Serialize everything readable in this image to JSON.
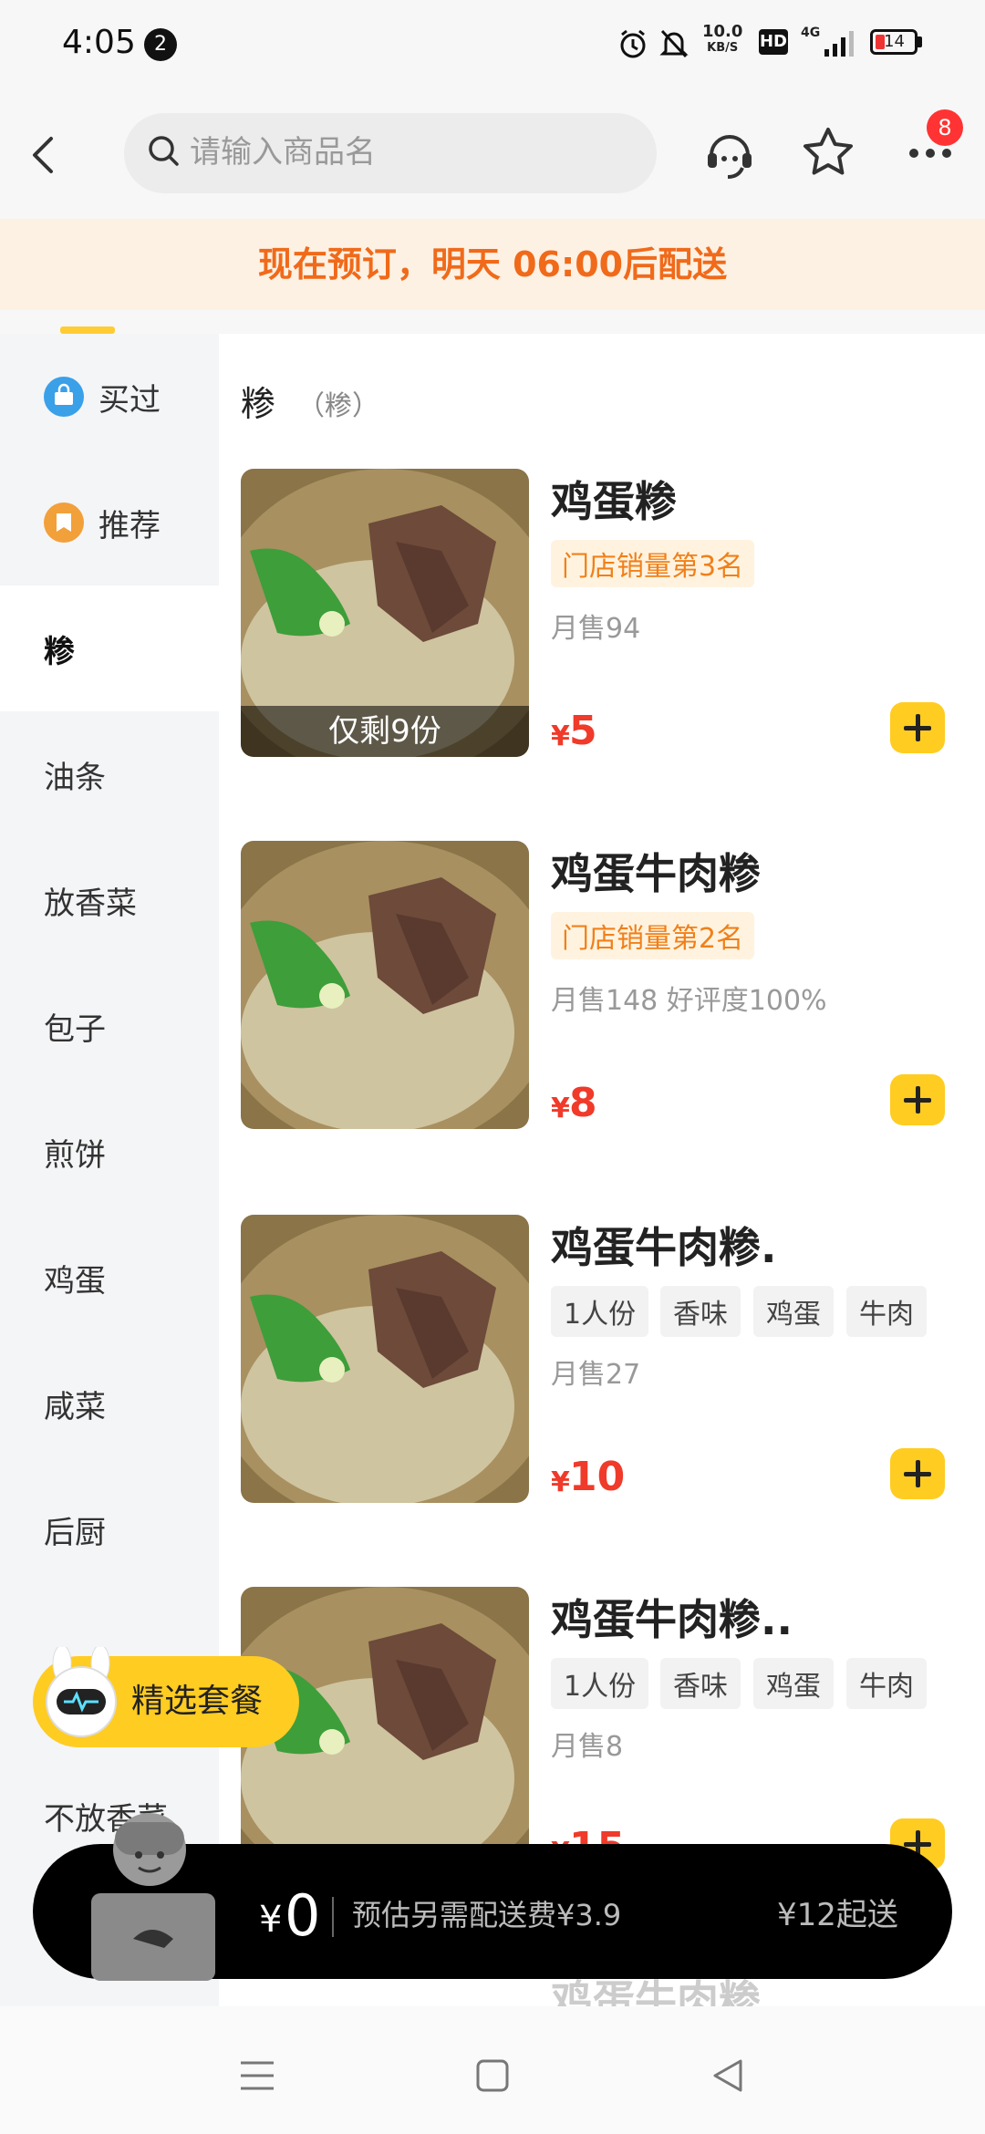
{
  "status": {
    "time": "4:05",
    "notif_count": "2",
    "speed_top": "10.0",
    "speed_bottom": "KB/S",
    "hd": "HD",
    "network": "4G",
    "battery": "14"
  },
  "header": {
    "search_placeholder": "请输入商品名",
    "more_badge": "8"
  },
  "banner": {
    "text": "现在预订，明天 06:00后配送"
  },
  "sidebar": {
    "items": [
      {
        "label": "买过",
        "icon": "bag-icon",
        "active": false
      },
      {
        "label": "推荐",
        "icon": "recommend-icon",
        "active": false
      },
      {
        "label": "糁",
        "active": true
      },
      {
        "label": "油条"
      },
      {
        "label": "放香菜"
      },
      {
        "label": "包子"
      },
      {
        "label": "煎饼"
      },
      {
        "label": "鸡蛋"
      },
      {
        "label": "咸菜"
      },
      {
        "label": "后厨"
      },
      {
        "label": "不放香菜"
      }
    ]
  },
  "category": {
    "title": "糁",
    "subtitle": "（糁）"
  },
  "products": [
    {
      "name": "鸡蛋糁",
      "rank": "门店销量第3名",
      "sales": "月售94",
      "price_symbol": "¥",
      "price": "5",
      "remain": "仅剩9份"
    },
    {
      "name": "鸡蛋牛肉糁",
      "rank": "门店销量第2名",
      "sales": "月售148  好评度100%",
      "price_symbol": "¥",
      "price": "8"
    },
    {
      "name": "鸡蛋牛肉糁.",
      "tags": [
        "1人份",
        "香味",
        "鸡蛋",
        "牛肉"
      ],
      "sales": "月售27",
      "price_symbol": "¥",
      "price": "10"
    },
    {
      "name": "鸡蛋牛肉糁..",
      "tags": [
        "1人份",
        "香味",
        "鸡蛋",
        "牛肉"
      ],
      "sales": "月售8",
      "price_symbol": "¥",
      "price": "15"
    },
    {
      "name": "鸡蛋牛肉糁..."
    }
  ],
  "combo": {
    "label": "精选套餐"
  },
  "cart": {
    "symbol": "¥",
    "total": "0",
    "fee_note": "预估另需配送费¥3.9",
    "min_order": "¥12起送"
  },
  "colors": {
    "accent": "#ffcc22",
    "price": "#f03a2a",
    "banner_text": "#f06a1a",
    "banner_bg": "#fdf1e3"
  }
}
